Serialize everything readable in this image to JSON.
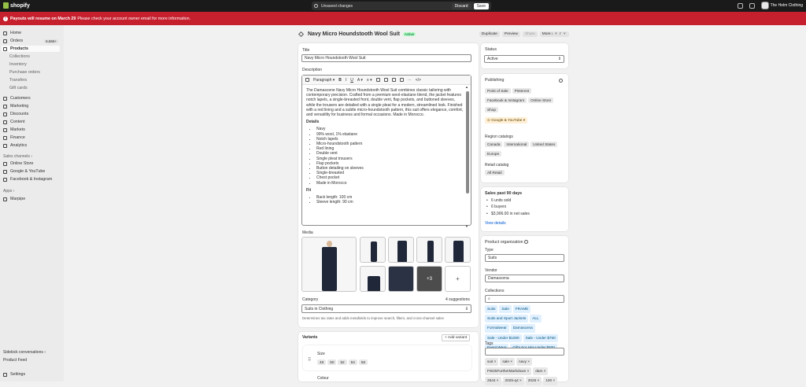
{
  "topbar": {
    "logo": "shopify",
    "unsaved_text": "Unsaved changes",
    "discard_label": "Discard",
    "save_label": "Save",
    "store_name": "The Helm Clothing"
  },
  "banner": {
    "bold": "Payouts will resume on March 29",
    "text": "Please check your account owner email for more information."
  },
  "sidebar": {
    "items": [
      {
        "label": "Home"
      },
      {
        "label": "Orders",
        "badge": "6,666+"
      },
      {
        "label": "Products"
      },
      {
        "label": "Collections"
      },
      {
        "label": "Inventory"
      },
      {
        "label": "Purchase orders"
      },
      {
        "label": "Transfers"
      },
      {
        "label": "Gift cards"
      },
      {
        "label": "Customers"
      },
      {
        "label": "Marketing"
      },
      {
        "label": "Discounts"
      },
      {
        "label": "Content"
      },
      {
        "label": "Markets"
      },
      {
        "label": "Finance"
      },
      {
        "label": "Analytics"
      }
    ],
    "sales_channels_label": "Sales channels",
    "channels": [
      "Online Store",
      "Google & YouTube",
      "Facebook & Instagram"
    ],
    "apps_label": "Apps",
    "apps": [
      "Marpipe"
    ],
    "bottom": [
      "Sidekick conversations",
      "Product Feed",
      "Settings"
    ]
  },
  "page": {
    "title": "Navy Micro Houndstooth Wool Suit",
    "status_badge": "Active",
    "actions": [
      "Duplicate",
      "Preview",
      "Share",
      "More actions"
    ]
  },
  "product": {
    "title_label": "Title",
    "title_value": "Navy Micro Houndstooth Wool Suit",
    "description_label": "Description",
    "paragraph_label": "Paragraph",
    "description_intro": "The Damascene Navy Micro Houndstooth Wool Suit combines classic tailoring with contemporary precision. Crafted from a premium wool-elastane blend, the jacket features notch lapels, a single-breasted front, double vent, flap pockets, and buttoned sleeves, while the trousers are detailed with a single pleat for a modern, streamlined look. Finished with a red lining and a subtle micro-houndstooth pattern, this suit offers elegance, comfort, and versatility for business and formal occasions. Made in Morocco.",
    "details_heading": "Details",
    "details": [
      "Navy",
      "99% wool, 1% elastane",
      "Notch lapels",
      "Micro-houndstooth pattern",
      "Red lining",
      "Double vent",
      "Single pleat trousers",
      "Flap pockets",
      "Button detailing on sleeves",
      "Single-breasted",
      "Chest pocket",
      "Made in Morocco"
    ],
    "fit_heading": "Fit",
    "fit": [
      "Back length: 100 cm",
      "Sleeve length: 90 cm"
    ],
    "media_label": "Media",
    "media_more": "+3",
    "media_add": "+",
    "category_label": "Category",
    "category_suggestions": "4 suggestions",
    "category_value": "Suits in Clothing",
    "category_help": "Determines tax rates and adds metafields to improve search, filters, and cross-channel sales",
    "variants_label": "Variants",
    "add_variant": "Add variant",
    "size_label": "Size",
    "sizes": [
      "46",
      "50",
      "52",
      "54",
      "56"
    ],
    "colour_label": "Colour"
  },
  "right": {
    "status_label": "Status",
    "status_value": "Active",
    "publishing_label": "Publishing",
    "publishing_channels": [
      "Point of Sale",
      "Pinterest",
      "Facebook & Instagram",
      "Online Store",
      "Shop"
    ],
    "google_channel": "Google & YouTube",
    "region_label": "Region catalogs",
    "regions": [
      "Canada",
      "International",
      "United States",
      "Europe"
    ],
    "retail_label": "Retail catalog",
    "retail": [
      "All Retail"
    ],
    "sales_title": "Sales past 90 days",
    "sales": [
      "6 units sold",
      "6 buyers",
      "$3,906.00 in net sales"
    ],
    "view_details": "View details",
    "org_title": "Product organization",
    "type_label": "Type",
    "type_value": "Suits",
    "vendor_label": "Vendor",
    "vendor_value": "Damascena",
    "collections_label": "Collections",
    "collections": [
      "Suits",
      "Sale",
      "FRAME",
      "Suits and Sport Jackets",
      "ALL",
      "Formalwear",
      "Damascena",
      "Sale - Under $1000",
      "Sale - Under $750",
      "Event Wear",
      "Gifts For Him Under $500"
    ],
    "tags_label": "Tags",
    "tags": [
      "suit",
      "sale",
      "navy",
      "FW25FurtherMarkdown",
      "dam",
      "2544",
      "2025-q4",
      "2025",
      "100"
    ]
  },
  "colors": {
    "accent": "#c6202e",
    "brand": "#95bf47",
    "active_badge": "#affebf"
  }
}
